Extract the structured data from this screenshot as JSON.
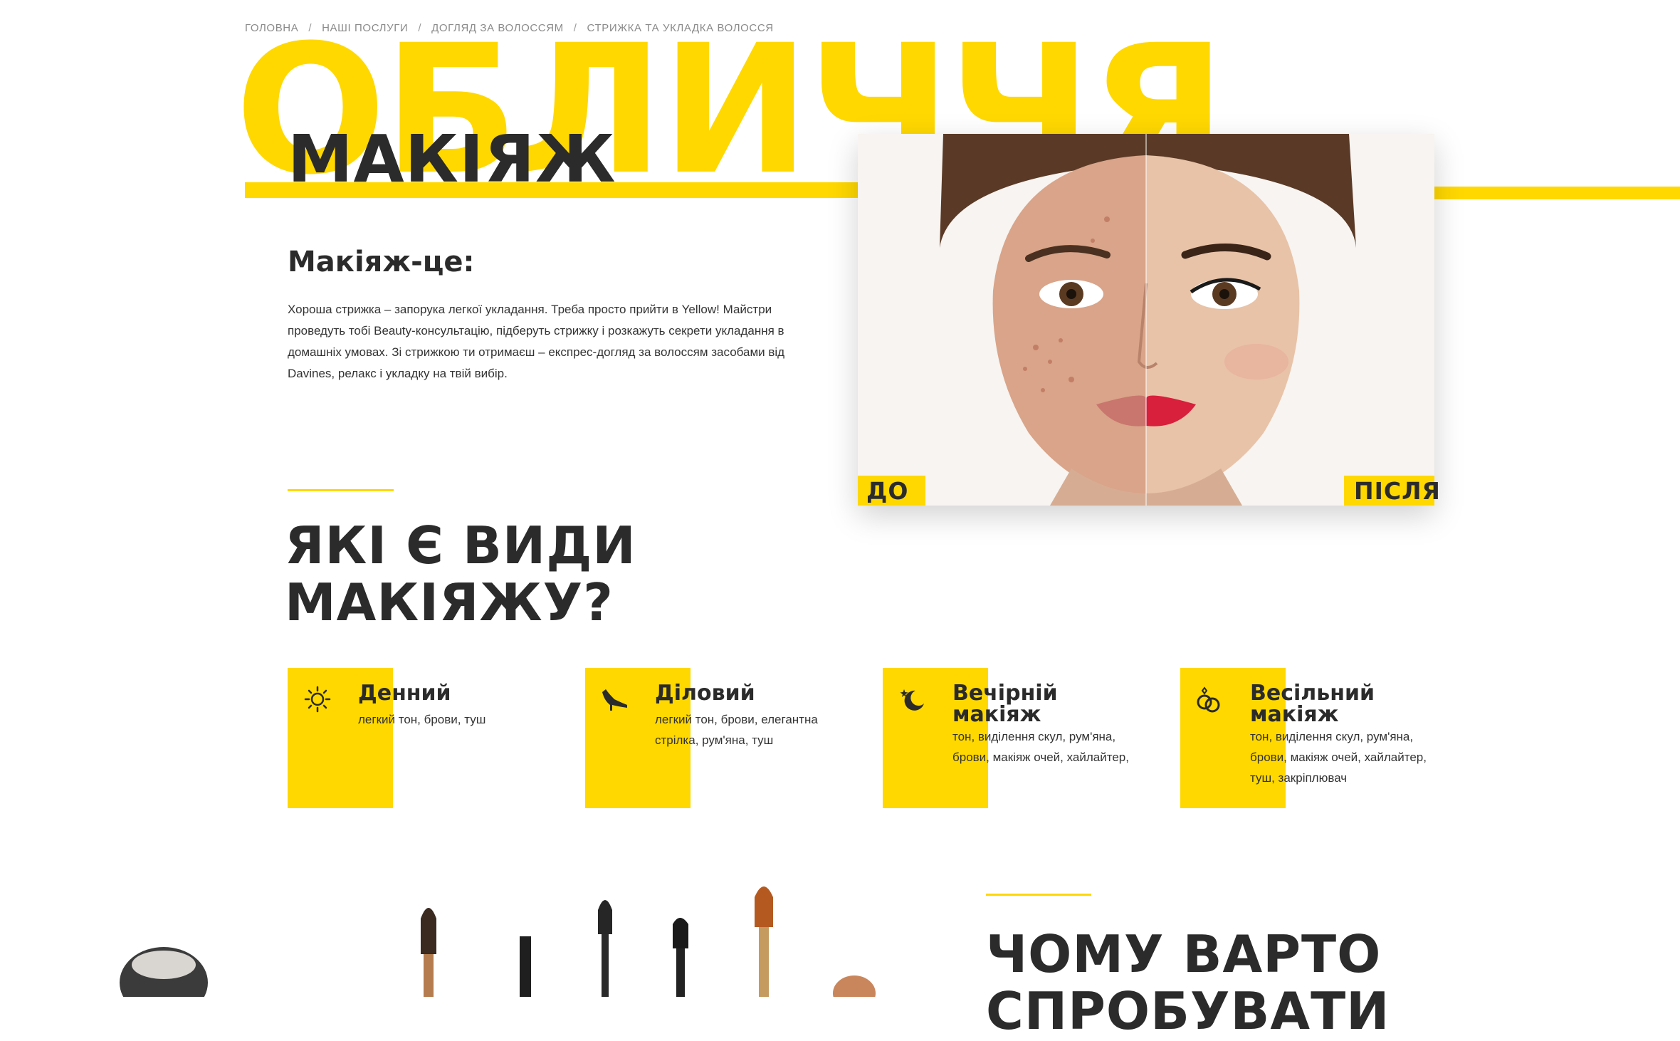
{
  "breadcrumb": [
    "ГОЛОВНА",
    "НАШІ ПОСЛУГИ",
    "ДОГЛЯД ЗА ВОЛОССЯМ",
    "СТРИЖКА ТА  УКЛАДКА ВОЛОССЯ"
  ],
  "hero": {
    "background_word": "ОБЛИЧЧЯ",
    "title": "МАКІЯЖ",
    "subtitle": "Макіяж-це:",
    "description": "Хороша стрижка – запорука легкої укладання. Треба просто прийти в Yellow! Майстри проведуть тобі Beauty-консультацію, підберуть стрижку і розкажуть секрети укладання в домашніх умовах.  Зі стрижкою ти отримаєш – експрес-догляд за волоссям засобами від Davines, релакс і укладку на твій вибір."
  },
  "photo": {
    "before_label": "ДО",
    "after_label": "ПІСЛЯ"
  },
  "types": {
    "title_line1": "ЯКІ Є ВИДИ",
    "title_line2": "МАКІЯЖУ?",
    "items": [
      {
        "icon": "sun-icon",
        "name_line1": "Денний",
        "name_line2": "",
        "desc": "легкий тон, брови, туш"
      },
      {
        "icon": "high-heel-icon",
        "name_line1": "Діловий",
        "name_line2": "",
        "desc": "легкий тон, брови, елегантна стрілка, рум'яна, туш"
      },
      {
        "icon": "moon-stars-icon",
        "name_line1": "Вечірній",
        "name_line2": "макіяж",
        "desc": "тон, виділення скул, рум'яна, брови, макіяж очей, хайлайтер,"
      },
      {
        "icon": "rings-icon",
        "name_line1": "Весільний",
        "name_line2": "макіяж",
        "desc": "тон, виділення скул, рум'яна, брови, макіяж очей, хайлайтер, туш, закріплювач"
      }
    ]
  },
  "why": {
    "title_line1": "ЧОМУ ВАРТО",
    "title_line2": "СПРОБУВАТИ"
  },
  "colors": {
    "accent": "#ffd800",
    "text": "#2b2b2b"
  }
}
